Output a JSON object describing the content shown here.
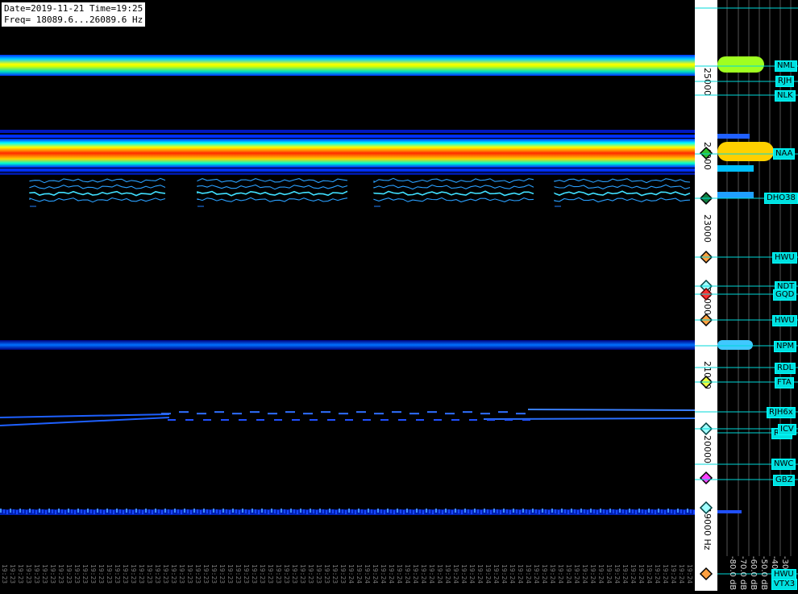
{
  "info": {
    "line1": "Date=2019-11-21 Time=19:25",
    "line2": "Freq= 18089.6...26089.6 Hz"
  },
  "freq_axis": {
    "ticks": [
      {
        "label": "25000"
      },
      {
        "label": "24000"
      },
      {
        "label": "23000"
      },
      {
        "label": "22000"
      },
      {
        "label": "21000"
      },
      {
        "label": "20000"
      },
      {
        "label": "19000 Hz"
      }
    ]
  },
  "stations": [
    "NML",
    "RJH",
    "NLK",
    "NAA",
    "DHO38",
    "HWU",
    "NDT",
    "GQD",
    "HWU",
    "NPM",
    "RDL",
    "FTA",
    "RJH6x",
    "ICV",
    "RDL",
    "NWC",
    "GBZ",
    "HWU",
    "VTX3"
  ],
  "level_axis": {
    "labels": [
      "-80.0 dB",
      "-70.0 dB",
      "-60.0 dB",
      "-50.0 dB",
      "-40.0 dB",
      "-30"
    ]
  },
  "timestamps_visible": "19:23 ... 19:25",
  "colors": {
    "background": "#000000",
    "strong_signal": "#ff3000",
    "medium_signal": "#ffff00",
    "weak_signal": "#0050ff",
    "marker_line": "#00e0e0"
  }
}
